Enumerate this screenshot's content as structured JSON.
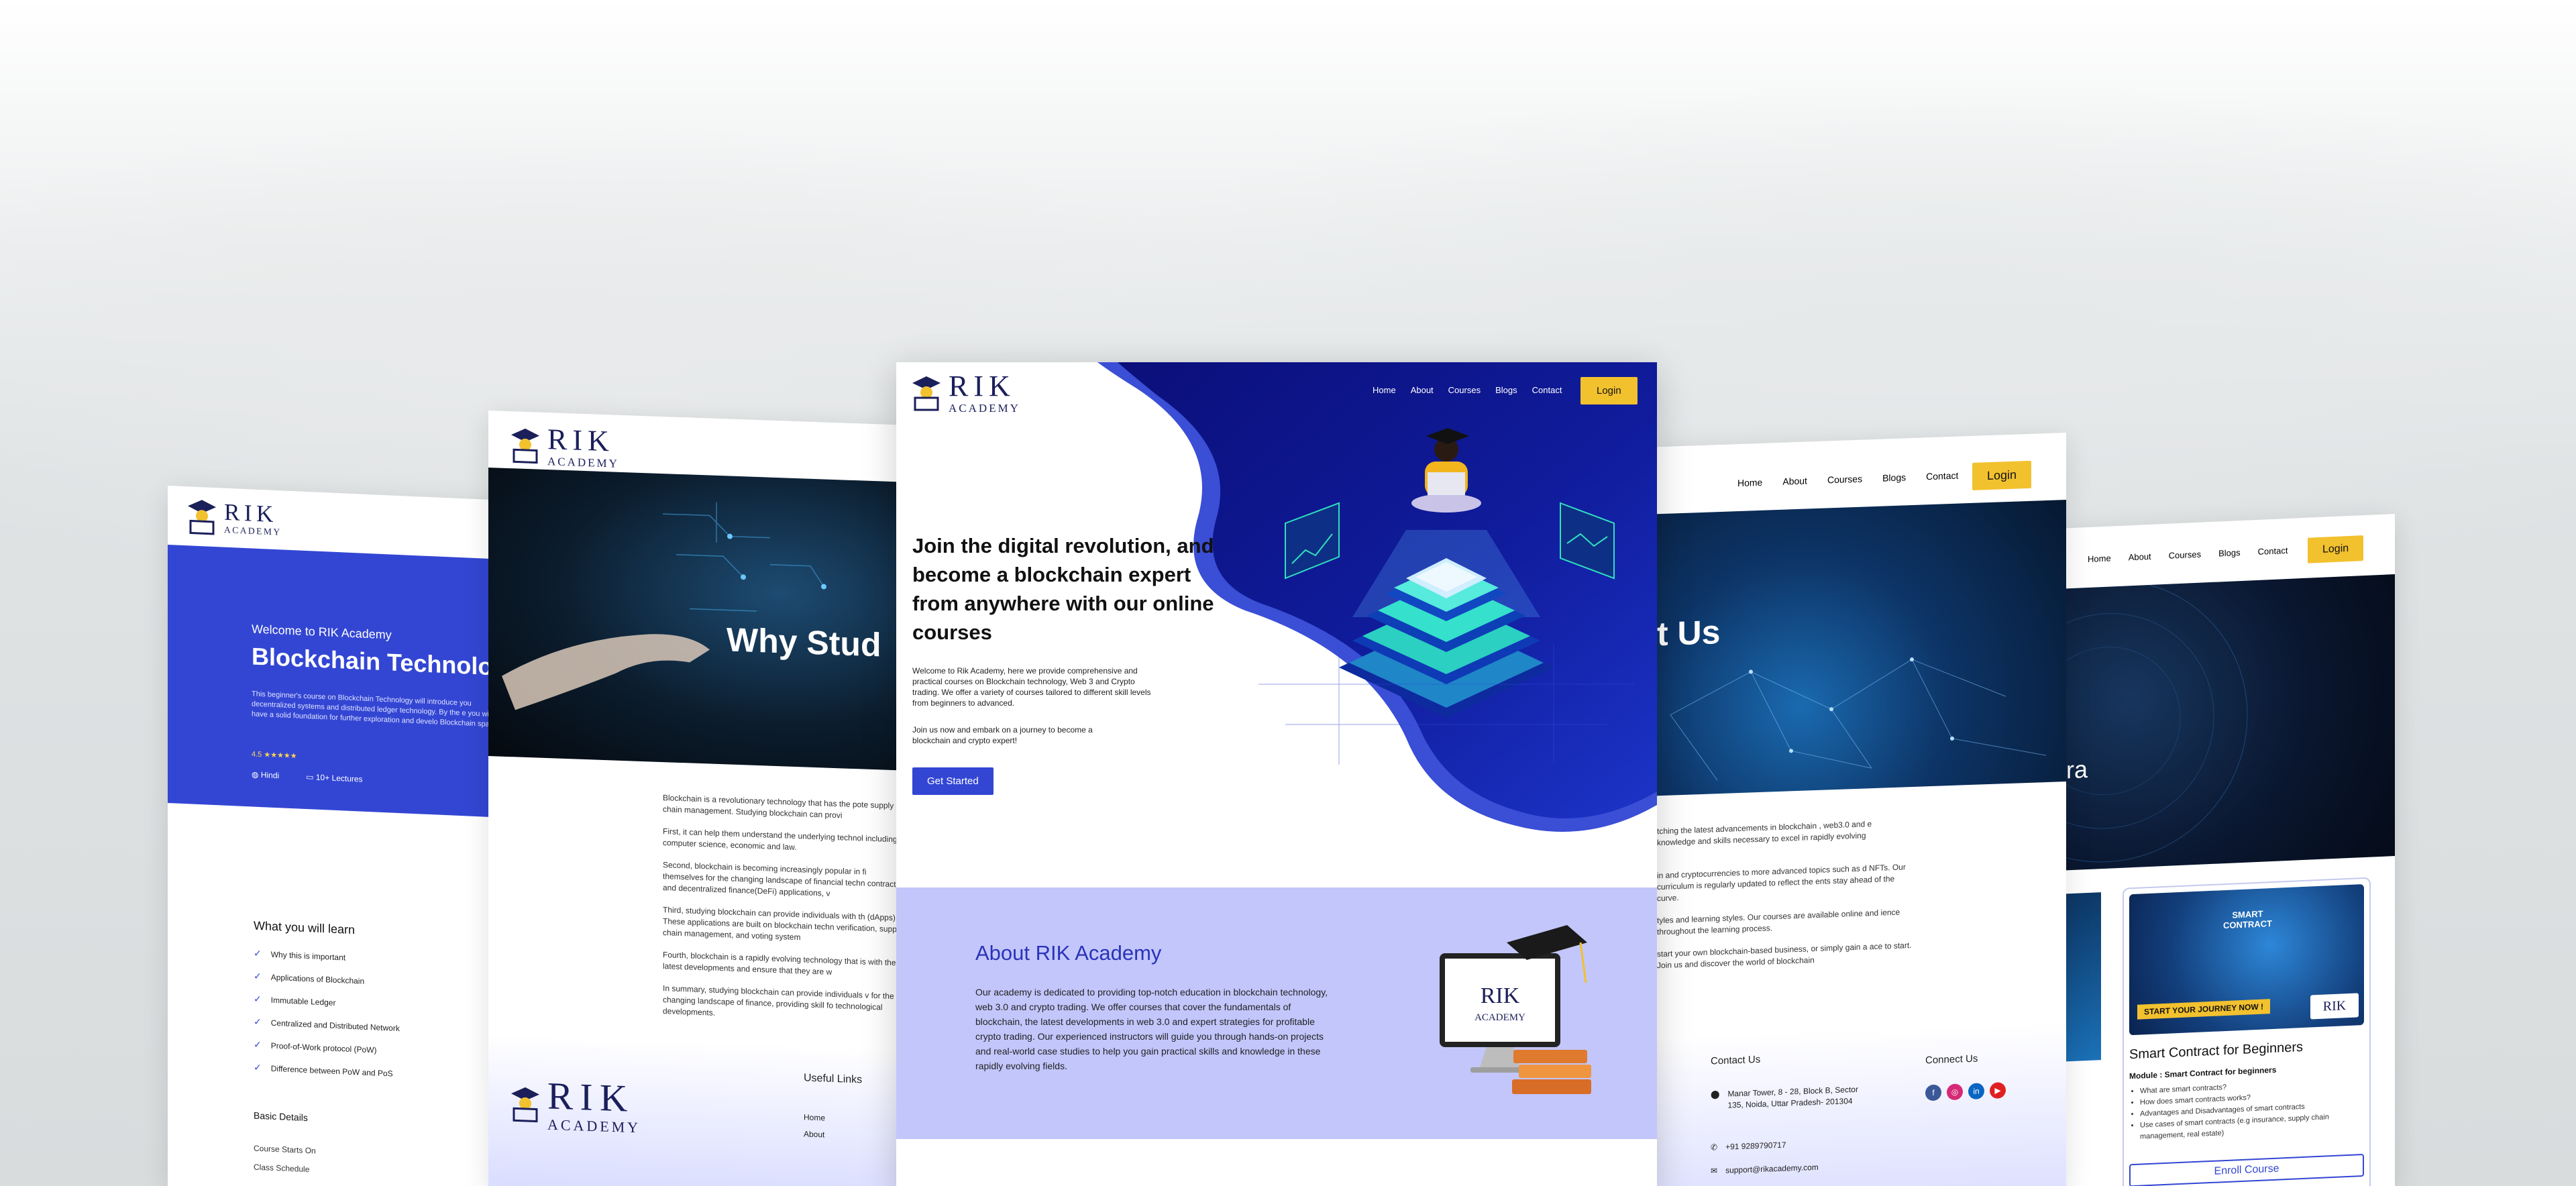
{
  "colors": {
    "primary_blue": "#3346d3",
    "navy": "#0b0f7a",
    "yellow": "#f2c12e",
    "lavender": "#c2c6fb",
    "dark_text": "#1b1f5a"
  },
  "logo": {
    "name": "RIK",
    "sub": "ACADEMY"
  },
  "center": {
    "nav": [
      "Home",
      "About",
      "Courses",
      "Blogs",
      "Contact"
    ],
    "login": "Login",
    "hero_title": "Join the digital revolution, and become a blockchain expert from anywhere with our online courses",
    "hero_p1": "Welcome to Rik Academy, here we provide comprehensive and practical courses on Blockchain technology, Web 3 and Crypto trading. We offer a variety of courses tailored to different skill levels from beginners to advanced.",
    "hero_p2": "Join us now and embark on a journey to become a blockchain and crypto expert!",
    "cta": "Get Started",
    "about_title": "About RIK Academy",
    "about_text": "Our academy is dedicated to providing top-notch education in blockchain technology, web 3.0 and crypto trading. We offer courses that cover the fundamentals of blockchain, the latest developments in web 3.0 and expert strategies for profitable crypto trading. Our experienced instructors will guide you through hands-on projects and real-world case studies to help you gain practical skills and knowledge in these rapidly evolving fields."
  },
  "left_far": {
    "welcome": "Welcome to RIK Academy",
    "title": "Blockchain Technolo",
    "desc": "This beginner's course on Blockchain Technology will introduce you decentralized systems and distributed ledger technology. By the e you will have a solid foundation for further exploration and develo Blockchain space.",
    "rating": "4.5 ★★★★★",
    "lang": "Hindi",
    "lectures": "10+ Lectures",
    "learn_title": "What you will learn",
    "learn": [
      "Why this is important",
      "Applications of Blockchain",
      "Immutable Ledger",
      "Centralized and Distributed Network",
      "Proof-of-Work protocol (PoW)",
      "Difference between PoW and PoS"
    ],
    "basic_title": "Basic Details",
    "basic": [
      "Course Starts On",
      "Class Schedule"
    ]
  },
  "left_near": {
    "hero_title": "Why Stud",
    "paras": [
      "Blockchain is a revolutionary technology that has the pote supply chain management. Studying blockchain can provi",
      "First, it can help them understand the underlying technol including computer science, economic and law.",
      "Second, blockchain is becoming increasingly popular in fi themselves for the changing landscape of financial techn contracts, and decentralized finance(DeFi) applications, v",
      "Third, studying blockchain can provide individuals with th (dApps). These applications are built on blockchain techn verification, supply chain management, and voting system",
      "Fourth, blockchain is a rapidly evolving technology that is with the latest developments and ensure that they are w",
      "In summary, studying blockchain can provide individuals v for the changing landscape of finance, providing skill fo technological developments."
    ],
    "footer_links_title": "Useful Links",
    "footer_links": [
      "Home",
      "About"
    ]
  },
  "right_near": {
    "nav": [
      "Home",
      "About",
      "Courses",
      "Blogs",
      "Contact"
    ],
    "login": "Login",
    "hero_title": "t Us",
    "paras": [
      "tching the latest advancements in blockchain , web3.0 and e knowledge and skills necessary to excel in rapidly evolving",
      "in and cryptocurrencies to more advanced topics such as d NFTs. Our curriculum is regularly updated to reflect the ents stay ahead of the curve.",
      "tyles and learning styles. Our courses are available online and ience throughout the learning process.",
      "start your own blockchain-based business, or simply gain a ace to start. Join us and discover the world of blockchain"
    ],
    "contact_title": "Contact Us",
    "address": "Manar Tower, 8 - 28, Block B, Sector 135, Noida, Uttar Pradesh- 201304",
    "phone": "+91 9289790717",
    "email": "support@rikacademy.com",
    "connect_title": "Connect Us"
  },
  "right_far": {
    "nav": [
      "Home",
      "About",
      "Courses",
      "Blogs",
      "Contact"
    ],
    "login": "Login",
    "hero_fragment": "ra",
    "card_banner_l1": "SMART",
    "card_banner_l2": "CONTRACT",
    "card_ribbon": "START YOUR JOURNEY NOW !",
    "card_title": "Smart Contract for Beginners",
    "module_label": "Module :",
    "module_name": "Smart Contract for beginners",
    "bullets": [
      "What are smart contracts?",
      "How does smart contracts works?",
      "Advantages and Disadvantages of smart contracts",
      "Use cases of smart contracts (e.g insurance, supply chain management, real estate)"
    ],
    "enroll": "Enroll Course"
  }
}
